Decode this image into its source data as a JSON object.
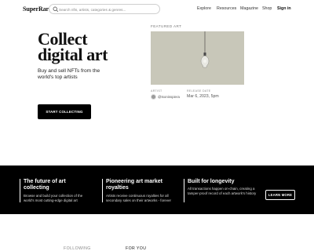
{
  "header": {
    "logo": "SuperRare",
    "search": {
      "placeholder": "Search nfts, artists, categories & genres..."
    },
    "nav": [
      {
        "label": "Explore"
      },
      {
        "label": "Resources"
      },
      {
        "label": "Magazine"
      },
      {
        "label": "Shop"
      },
      {
        "label": "Sign in"
      }
    ]
  },
  "hero": {
    "title_line1": "Collect",
    "title_line2": "digital art",
    "subtitle": "Buy and sell NFTs from the world's top artists",
    "cta": "START COLLECTING"
  },
  "featured": {
    "label": "FEATURED ART",
    "artist_label": "ARTIST",
    "artist_name": "@tsonisspiera",
    "release_label": "RELEASE DATE",
    "release_date": "Mar 6, 2023, 5pm"
  },
  "features": [
    {
      "title_line1": "The future of art",
      "title_line2": "collecting",
      "text_line1": "Browse and build your collection of the",
      "text_line2": "world's most cutting-edge digital art"
    },
    {
      "title_line1": "Pioneering art market",
      "title_line2": "royalties",
      "text_line1": "Artists receive continuous royalties for all",
      "text_line2": "secondary sales on their artworks - forever"
    },
    {
      "title_line1": "Built for longevity",
      "text_line1": "All transactions happen on-chain, creating a",
      "text_line2": "tamper-proof record of each artwork's history"
    }
  ],
  "learn_more": "LEARN MORE",
  "tabs": [
    {
      "label": "FOLLOWING"
    },
    {
      "label": "FOR YOU"
    }
  ]
}
